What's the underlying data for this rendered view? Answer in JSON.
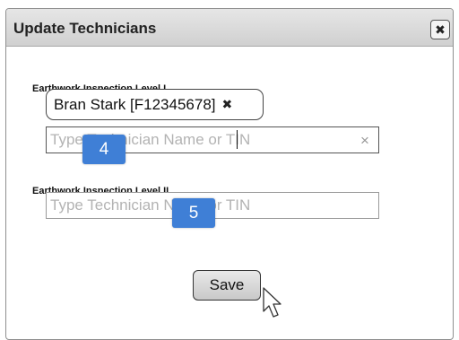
{
  "dialog": {
    "title": "Update Technicians",
    "close_icon": "close-icon"
  },
  "level1": {
    "label": "Earthwork Inspection Level I",
    "selected_token": "Bran Stark [F12345678]",
    "token_remove_icon": "x-icon",
    "placeholder": "Type Technician Name or TIN",
    "clear_icon": "clear-icon",
    "badge": "4"
  },
  "level2": {
    "label": "Earthwork Inspection Level II",
    "placeholder": "Type Technician Name or TIN",
    "badge": "5"
  },
  "save_label": "Save",
  "colors": {
    "badge": "#3f7fd6",
    "titlebar": "#d9d9d9"
  }
}
